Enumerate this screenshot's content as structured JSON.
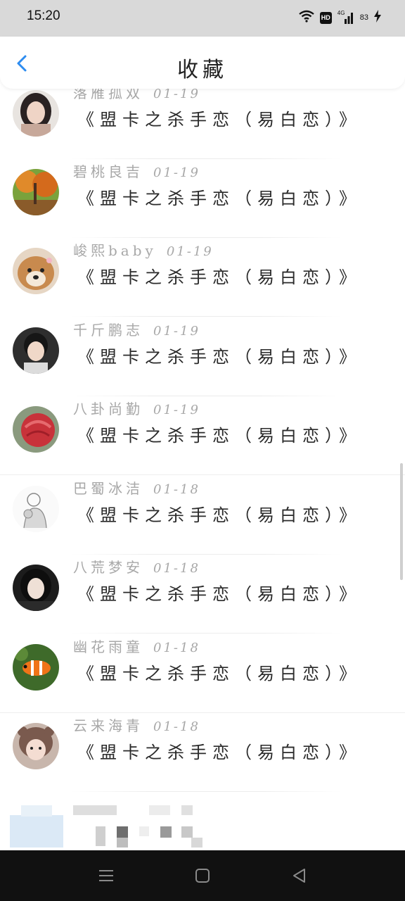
{
  "status_bar": {
    "time": "15:20",
    "hd": "HD",
    "network": "4G",
    "battery": "83"
  },
  "header": {
    "title": "收藏",
    "back_icon": "chevron-left-icon"
  },
  "items": [
    {
      "name": "落雁孤双",
      "date": "01-19",
      "title": "《盟卡之杀手恋（易白恋）》"
    },
    {
      "name": "碧桃良吉",
      "date": "01-19",
      "title": "《盟卡之杀手恋（易白恋）》"
    },
    {
      "name": "峻熙baby",
      "date": "01-19",
      "title": "《盟卡之杀手恋（易白恋）》"
    },
    {
      "name": "千斤鹏志",
      "date": "01-19",
      "title": "《盟卡之杀手恋（易白恋）》"
    },
    {
      "name": "八卦尚勤",
      "date": "01-19",
      "title": "《盟卡之杀手恋（易白恋）》"
    },
    {
      "name": "巴蜀冰洁",
      "date": "01-18",
      "title": "《盟卡之杀手恋（易白恋）》"
    },
    {
      "name": "八荒梦安",
      "date": "01-18",
      "title": "《盟卡之杀手恋（易白恋）》"
    },
    {
      "name": "幽花雨童",
      "date": "01-18",
      "title": "《盟卡之杀手恋（易白恋）》"
    },
    {
      "name": "云来海青",
      "date": "01-18",
      "title": "《盟卡之杀手恋（易白恋）》"
    }
  ],
  "colors": {
    "accent": "#2d8cf0",
    "status_bar_bg": "#d9d9d9",
    "nav_bar_bg": "#111111"
  },
  "icons": {
    "wifi": "wifi-icon",
    "signal": "signal-icon",
    "charging": "charging-icon",
    "nav_menu": "menu-icon",
    "nav_home": "home-icon",
    "nav_back": "back-triangle-icon"
  }
}
